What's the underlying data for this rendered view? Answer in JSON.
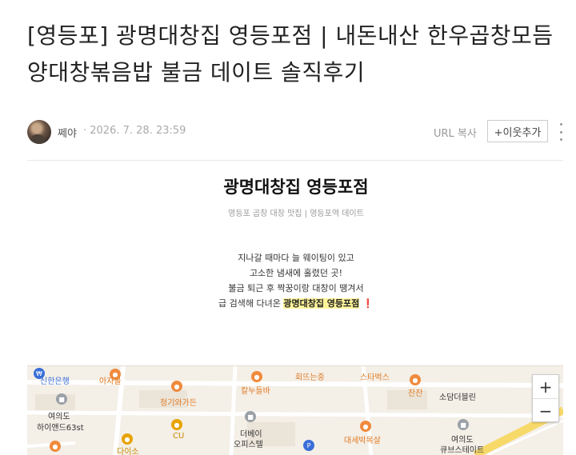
{
  "post": {
    "title": "[영등포] 광명대창집 영등포점 | 내돈내산 한우곱창모듬 양대창볶음밥 불금 데이트 솔직후기",
    "author": "쩨야",
    "date": "· 2026. 7. 28. 23:59",
    "url_copy": "URL 복사",
    "follow": "+이웃추가"
  },
  "content": {
    "heading": "광명대창집 영등포점",
    "subheading": "영등포 곱창 대창 맛집 | 영등포역 데이트",
    "lines": [
      "지나갈 때마다 늘 웨이팅이 있고",
      "고소한 냄새에 홀렸던 곳!",
      "불금 퇴근 후 짝꿍이랑 대창이 땡겨서"
    ],
    "last_line_prefix": "급 검색해 다녀온 ",
    "last_line_highlight": "광명대창집 영등포점",
    "last_line_suffix": "❗"
  },
  "map": {
    "labels": [
      {
        "text": "신한은행",
        "style": "blue"
      },
      {
        "text": "아자몰",
        "style": "orange"
      },
      {
        "text": "회뜨는중",
        "style": "orange"
      },
      {
        "text": "스타벅스",
        "style": "orange"
      },
      {
        "text": "칼누들바",
        "style": "orange"
      },
      {
        "text": "청기와가든",
        "style": "orange"
      },
      {
        "text": "잔잔",
        "style": "orange"
      },
      {
        "text": "소담더블린",
        "style": ""
      },
      {
        "text": "여의도",
        "style": ""
      },
      {
        "text": "하이앤드63st",
        "style": ""
      },
      {
        "text": "CU",
        "style": "gold"
      },
      {
        "text": "더베이",
        "style": ""
      },
      {
        "text": "오피스텔",
        "style": ""
      },
      {
        "text": "대세박목살",
        "style": "orange"
      },
      {
        "text": "여의도",
        "style": ""
      },
      {
        "text": "큐브스테이트",
        "style": ""
      },
      {
        "text": "다이소",
        "style": "gold"
      }
    ],
    "zoom_in": "+",
    "zoom_out": "−"
  }
}
